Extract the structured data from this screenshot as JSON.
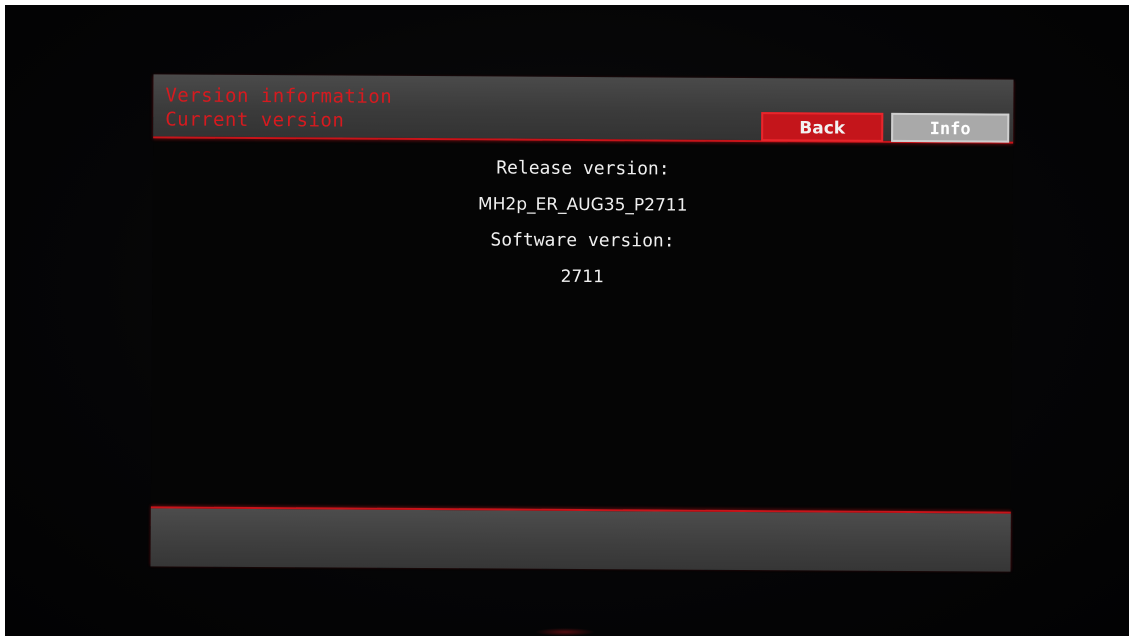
{
  "header": {
    "title_line1": "Version information",
    "title_line2": "Current version",
    "back_label": "Back",
    "info_label": "Info"
  },
  "content": {
    "release_label": "Release version:",
    "release_value": "MH2p_ER_AUG35_P2711",
    "software_label": "Software version:",
    "software_value": "2711"
  },
  "colors": {
    "accent_red": "#c8141a",
    "bar_gray": "#3e3e3e",
    "info_button_gray": "#a9a9a9"
  }
}
